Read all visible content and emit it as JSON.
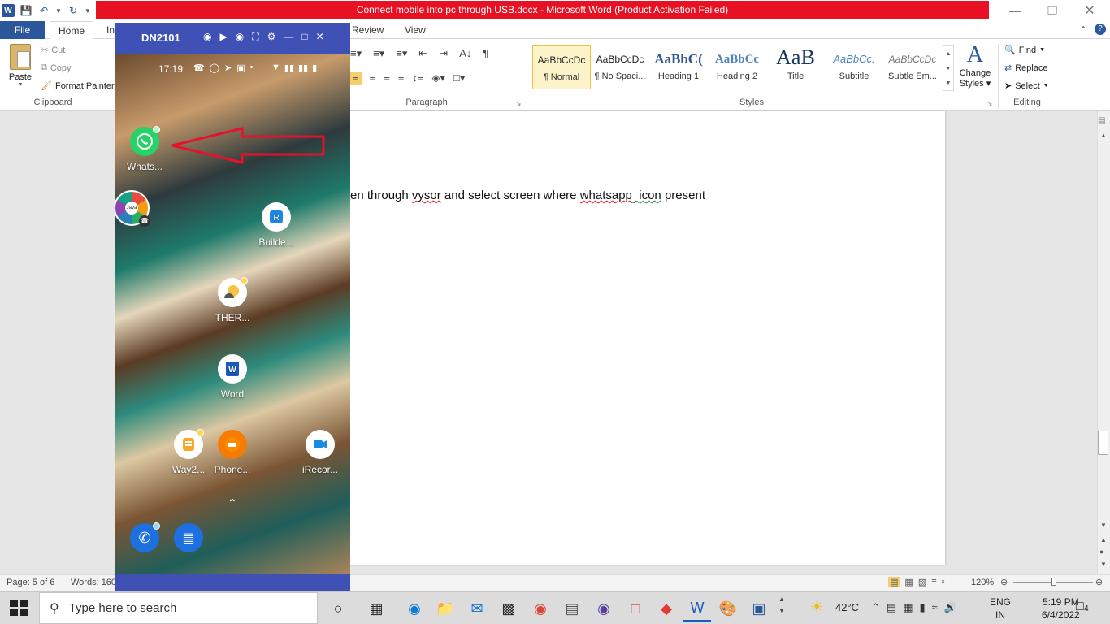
{
  "window": {
    "title": "Connect mobile into pc through USB.docx  -  Microsoft Word (Product Activation Failed)"
  },
  "tabs": [
    "File",
    "Home",
    "In",
    "Review",
    "View"
  ],
  "clipboard": {
    "paste": "Paste",
    "cut": "Cut",
    "copy": "Copy",
    "format_painter": "Format Painter",
    "group_label": "Clipboard"
  },
  "paragraph": {
    "group_label": "Paragraph"
  },
  "styles": {
    "group_label": "Styles",
    "items": [
      {
        "sample": "AaBbCcDc",
        "name": "¶ Normal"
      },
      {
        "sample": "AaBbCcDc",
        "name": "¶ No Spaci..."
      },
      {
        "sample": "AaBbC(",
        "name": "Heading 1"
      },
      {
        "sample": "AaBbCc",
        "name": "Heading 2"
      },
      {
        "sample": "AaB",
        "name": "Title"
      },
      {
        "sample": "AaBbCc.",
        "name": "Subtitle"
      },
      {
        "sample": "AaBbCcDc",
        "name": "Subtle Em..."
      }
    ],
    "change_styles_line1": "Change",
    "change_styles_line2": "Styles"
  },
  "editing": {
    "find": "Find",
    "replace": "Replace",
    "select": "Select",
    "group_label": "Editing"
  },
  "document": {
    "text_prefix": "en through ",
    "word_vysor": "vysor",
    "text_mid": " and select screen where ",
    "word_whatsapp": "whatsapp",
    "text_space": "  ",
    "word_icon": "icon",
    "text_suffix": " present"
  },
  "status": {
    "page": "Page: 5 of 6",
    "words": "Words: 160",
    "zoom": "120%"
  },
  "phone": {
    "device": "DN2101",
    "time": "17:19",
    "apps": [
      {
        "label": "Whats...",
        "icon": "whatsapp-icon"
      },
      {
        "label": "Builde...",
        "icon": "builder-icon"
      },
      {
        "label": "THER...",
        "icon": "weather-icon"
      },
      {
        "label": "Word",
        "icon": "word-icon"
      },
      {
        "label": "Way2...",
        "icon": "way2-icon"
      },
      {
        "label": "Phone...",
        "icon": "phonepe-icon"
      },
      {
        "label": "iRecor...",
        "icon": "irecorder-icon"
      }
    ],
    "java_label": "Java"
  },
  "taskbar": {
    "search_placeholder": "Type here to search",
    "temperature": "42°C",
    "lang1": "ENG",
    "lang2": "IN",
    "time": "5:19 PM",
    "date": "6/4/2022",
    "notifications": "4"
  },
  "colors": {
    "accent": "#2b579a",
    "title_error": "#e81123",
    "vysor_bar": "#3f51b5",
    "whatsapp": "#25d366",
    "arrow": "#e8102a"
  }
}
